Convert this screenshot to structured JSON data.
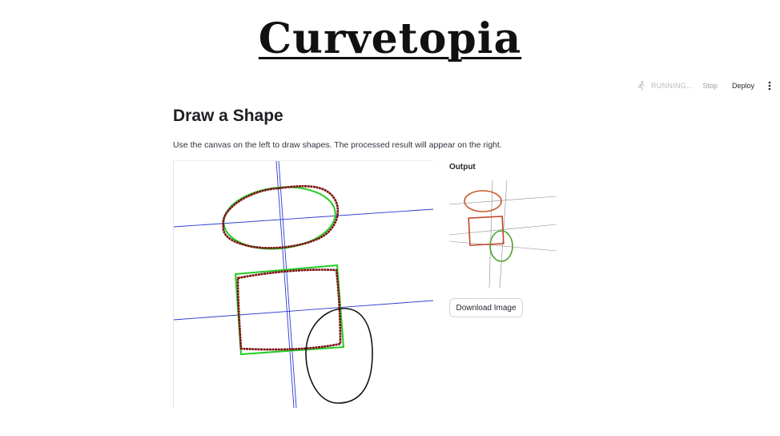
{
  "banner": {
    "title": "Curvetopia"
  },
  "toolbar": {
    "status": "RUNNING...",
    "stop_label": "Stop",
    "deploy_label": "Deploy",
    "menu_icon": "kebab-menu-icon",
    "status_icon": "running-person-icon"
  },
  "main": {
    "heading": "Draw a Shape",
    "description": "Use the canvas on the left to draw shapes. The processed result will appear on the right."
  },
  "output": {
    "label": "Output",
    "download_label": "Download Image"
  },
  "colors": {
    "drawn_stroke": "#7a0f0f",
    "fitted_shape": "#22cc22",
    "symmetry_line": "#2233cc",
    "unfitted_stroke": "#111111",
    "output_stroke": "#c45a2a"
  }
}
